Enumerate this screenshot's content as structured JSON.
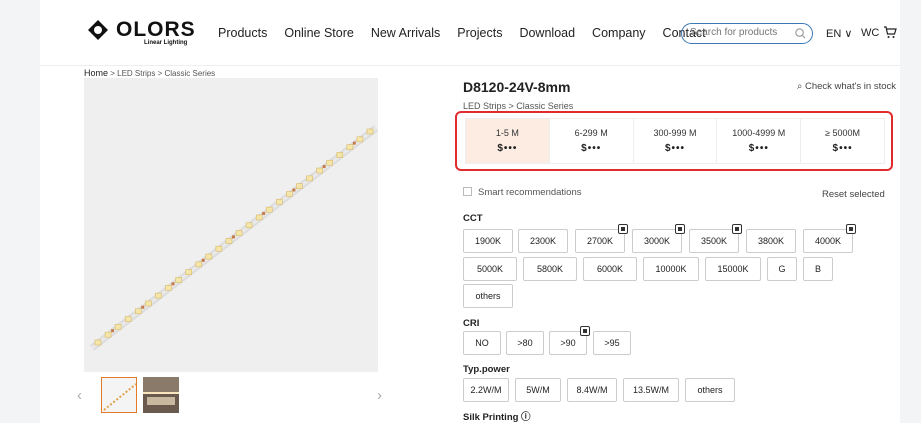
{
  "header": {
    "logo_word": "OLORS",
    "logo_sub": "Linear Lighting",
    "nav": [
      "Products",
      "Online Store",
      "New Arrivals",
      "Projects",
      "Download",
      "Company",
      "Contact"
    ],
    "search_placeholder": "Search for products",
    "lang": "EN ∨",
    "wc": "WC"
  },
  "breadcrumb": {
    "home": "Home",
    "path": " > LED Strips > Classic Series"
  },
  "product": {
    "title": "D8120-24V-8mm",
    "stock": "Check what's in stock",
    "category": "LED Strips > Classic Series"
  },
  "price_tiers": [
    {
      "range": "1-5 M",
      "price": "$•••"
    },
    {
      "range": "6-299 M",
      "price": "$•••"
    },
    {
      "range": "300-999 M",
      "price": "$•••"
    },
    {
      "range": "1000-4999 M",
      "price": "$•••"
    },
    {
      "range": "≥ 5000M",
      "price": "$•••"
    }
  ],
  "smart_label": "Smart recommendations",
  "reset_label": "Reset selected",
  "cct": {
    "label": "CCT",
    "options": [
      "1900K",
      "2300K",
      "2700K",
      "3000K",
      "3500K",
      "3800K",
      "4000K",
      "5000K",
      "5800K",
      "6000K",
      "10000K",
      "15000K",
      "G",
      "B",
      "others"
    ]
  },
  "cri": {
    "label": "CRI",
    "options": [
      "NO",
      ">80",
      ">90",
      ">95"
    ]
  },
  "power": {
    "label": "Typ.power",
    "options": [
      "2.2W/M",
      "5W/M",
      "8.4W/M",
      "13.5W/M",
      "others"
    ]
  },
  "silk": {
    "label": "Silk Printing ⓘ"
  },
  "colors": {
    "accent": "#e27a2c",
    "highlight": "#e02c2c",
    "search_border": "#3b78b6"
  }
}
